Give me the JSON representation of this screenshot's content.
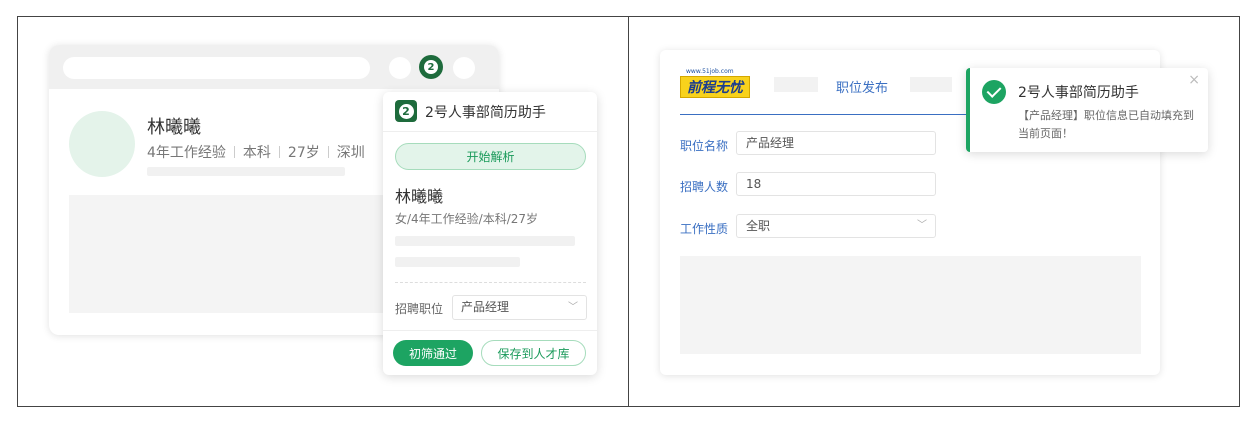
{
  "left": {
    "candidate": {
      "name": "林曦曦",
      "meta": [
        "4年工作经验",
        "本科",
        "27岁",
        "深圳"
      ]
    },
    "extension_icon_text": "2"
  },
  "popup": {
    "logo_text": "2",
    "title": "2号人事部简历助手",
    "parse_button": "开始解析",
    "name": "林曦曦",
    "meta": "女/4年工作经验/本科/27岁",
    "position_label": "招聘职位",
    "position_value": "产品经理",
    "pass_button": "初筛通过",
    "save_button": "保存到人才库"
  },
  "job_site": {
    "logo_url": "www.51job.com",
    "logo_brand": "前程无忧",
    "active_tab": "职位发布",
    "fields": [
      {
        "label": "职位名称",
        "value": "产品经理"
      },
      {
        "label": "招聘人数",
        "value": "18"
      },
      {
        "label": "工作性质",
        "value": "全职"
      }
    ]
  },
  "toast": {
    "title": "2号人事部简历助手",
    "message": "【产品经理】职位信息已自动填充到当前页面！",
    "close": "×"
  },
  "colors": {
    "brand_green": "#1da462",
    "link_blue": "#3a6fc2",
    "logo_yellow": "#f8d21c"
  }
}
